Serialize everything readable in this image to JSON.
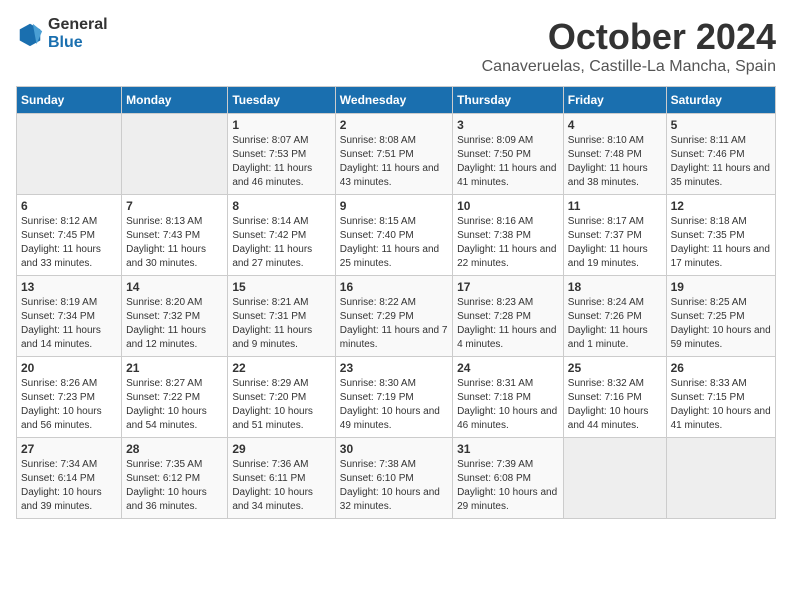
{
  "header": {
    "logo_general": "General",
    "logo_blue": "Blue",
    "month_title": "October 2024",
    "location": "Canaveruelas, Castille-La Mancha, Spain"
  },
  "columns": [
    "Sunday",
    "Monday",
    "Tuesday",
    "Wednesday",
    "Thursday",
    "Friday",
    "Saturday"
  ],
  "weeks": [
    [
      {
        "day": "",
        "sunrise": "",
        "sunset": "",
        "daylight": ""
      },
      {
        "day": "",
        "sunrise": "",
        "sunset": "",
        "daylight": ""
      },
      {
        "day": "1",
        "sunrise": "Sunrise: 8:07 AM",
        "sunset": "Sunset: 7:53 PM",
        "daylight": "Daylight: 11 hours and 46 minutes."
      },
      {
        "day": "2",
        "sunrise": "Sunrise: 8:08 AM",
        "sunset": "Sunset: 7:51 PM",
        "daylight": "Daylight: 11 hours and 43 minutes."
      },
      {
        "day": "3",
        "sunrise": "Sunrise: 8:09 AM",
        "sunset": "Sunset: 7:50 PM",
        "daylight": "Daylight: 11 hours and 41 minutes."
      },
      {
        "day": "4",
        "sunrise": "Sunrise: 8:10 AM",
        "sunset": "Sunset: 7:48 PM",
        "daylight": "Daylight: 11 hours and 38 minutes."
      },
      {
        "day": "5",
        "sunrise": "Sunrise: 8:11 AM",
        "sunset": "Sunset: 7:46 PM",
        "daylight": "Daylight: 11 hours and 35 minutes."
      }
    ],
    [
      {
        "day": "6",
        "sunrise": "Sunrise: 8:12 AM",
        "sunset": "Sunset: 7:45 PM",
        "daylight": "Daylight: 11 hours and 33 minutes."
      },
      {
        "day": "7",
        "sunrise": "Sunrise: 8:13 AM",
        "sunset": "Sunset: 7:43 PM",
        "daylight": "Daylight: 11 hours and 30 minutes."
      },
      {
        "day": "8",
        "sunrise": "Sunrise: 8:14 AM",
        "sunset": "Sunset: 7:42 PM",
        "daylight": "Daylight: 11 hours and 27 minutes."
      },
      {
        "day": "9",
        "sunrise": "Sunrise: 8:15 AM",
        "sunset": "Sunset: 7:40 PM",
        "daylight": "Daylight: 11 hours and 25 minutes."
      },
      {
        "day": "10",
        "sunrise": "Sunrise: 8:16 AM",
        "sunset": "Sunset: 7:38 PM",
        "daylight": "Daylight: 11 hours and 22 minutes."
      },
      {
        "day": "11",
        "sunrise": "Sunrise: 8:17 AM",
        "sunset": "Sunset: 7:37 PM",
        "daylight": "Daylight: 11 hours and 19 minutes."
      },
      {
        "day": "12",
        "sunrise": "Sunrise: 8:18 AM",
        "sunset": "Sunset: 7:35 PM",
        "daylight": "Daylight: 11 hours and 17 minutes."
      }
    ],
    [
      {
        "day": "13",
        "sunrise": "Sunrise: 8:19 AM",
        "sunset": "Sunset: 7:34 PM",
        "daylight": "Daylight: 11 hours and 14 minutes."
      },
      {
        "day": "14",
        "sunrise": "Sunrise: 8:20 AM",
        "sunset": "Sunset: 7:32 PM",
        "daylight": "Daylight: 11 hours and 12 minutes."
      },
      {
        "day": "15",
        "sunrise": "Sunrise: 8:21 AM",
        "sunset": "Sunset: 7:31 PM",
        "daylight": "Daylight: 11 hours and 9 minutes."
      },
      {
        "day": "16",
        "sunrise": "Sunrise: 8:22 AM",
        "sunset": "Sunset: 7:29 PM",
        "daylight": "Daylight: 11 hours and 7 minutes."
      },
      {
        "day": "17",
        "sunrise": "Sunrise: 8:23 AM",
        "sunset": "Sunset: 7:28 PM",
        "daylight": "Daylight: 11 hours and 4 minutes."
      },
      {
        "day": "18",
        "sunrise": "Sunrise: 8:24 AM",
        "sunset": "Sunset: 7:26 PM",
        "daylight": "Daylight: 11 hours and 1 minute."
      },
      {
        "day": "19",
        "sunrise": "Sunrise: 8:25 AM",
        "sunset": "Sunset: 7:25 PM",
        "daylight": "Daylight: 10 hours and 59 minutes."
      }
    ],
    [
      {
        "day": "20",
        "sunrise": "Sunrise: 8:26 AM",
        "sunset": "Sunset: 7:23 PM",
        "daylight": "Daylight: 10 hours and 56 minutes."
      },
      {
        "day": "21",
        "sunrise": "Sunrise: 8:27 AM",
        "sunset": "Sunset: 7:22 PM",
        "daylight": "Daylight: 10 hours and 54 minutes."
      },
      {
        "day": "22",
        "sunrise": "Sunrise: 8:29 AM",
        "sunset": "Sunset: 7:20 PM",
        "daylight": "Daylight: 10 hours and 51 minutes."
      },
      {
        "day": "23",
        "sunrise": "Sunrise: 8:30 AM",
        "sunset": "Sunset: 7:19 PM",
        "daylight": "Daylight: 10 hours and 49 minutes."
      },
      {
        "day": "24",
        "sunrise": "Sunrise: 8:31 AM",
        "sunset": "Sunset: 7:18 PM",
        "daylight": "Daylight: 10 hours and 46 minutes."
      },
      {
        "day": "25",
        "sunrise": "Sunrise: 8:32 AM",
        "sunset": "Sunset: 7:16 PM",
        "daylight": "Daylight: 10 hours and 44 minutes."
      },
      {
        "day": "26",
        "sunrise": "Sunrise: 8:33 AM",
        "sunset": "Sunset: 7:15 PM",
        "daylight": "Daylight: 10 hours and 41 minutes."
      }
    ],
    [
      {
        "day": "27",
        "sunrise": "Sunrise: 7:34 AM",
        "sunset": "Sunset: 6:14 PM",
        "daylight": "Daylight: 10 hours and 39 minutes."
      },
      {
        "day": "28",
        "sunrise": "Sunrise: 7:35 AM",
        "sunset": "Sunset: 6:12 PM",
        "daylight": "Daylight: 10 hours and 36 minutes."
      },
      {
        "day": "29",
        "sunrise": "Sunrise: 7:36 AM",
        "sunset": "Sunset: 6:11 PM",
        "daylight": "Daylight: 10 hours and 34 minutes."
      },
      {
        "day": "30",
        "sunrise": "Sunrise: 7:38 AM",
        "sunset": "Sunset: 6:10 PM",
        "daylight": "Daylight: 10 hours and 32 minutes."
      },
      {
        "day": "31",
        "sunrise": "Sunrise: 7:39 AM",
        "sunset": "Sunset: 6:08 PM",
        "daylight": "Daylight: 10 hours and 29 minutes."
      },
      {
        "day": "",
        "sunrise": "",
        "sunset": "",
        "daylight": ""
      },
      {
        "day": "",
        "sunrise": "",
        "sunset": "",
        "daylight": ""
      }
    ]
  ]
}
